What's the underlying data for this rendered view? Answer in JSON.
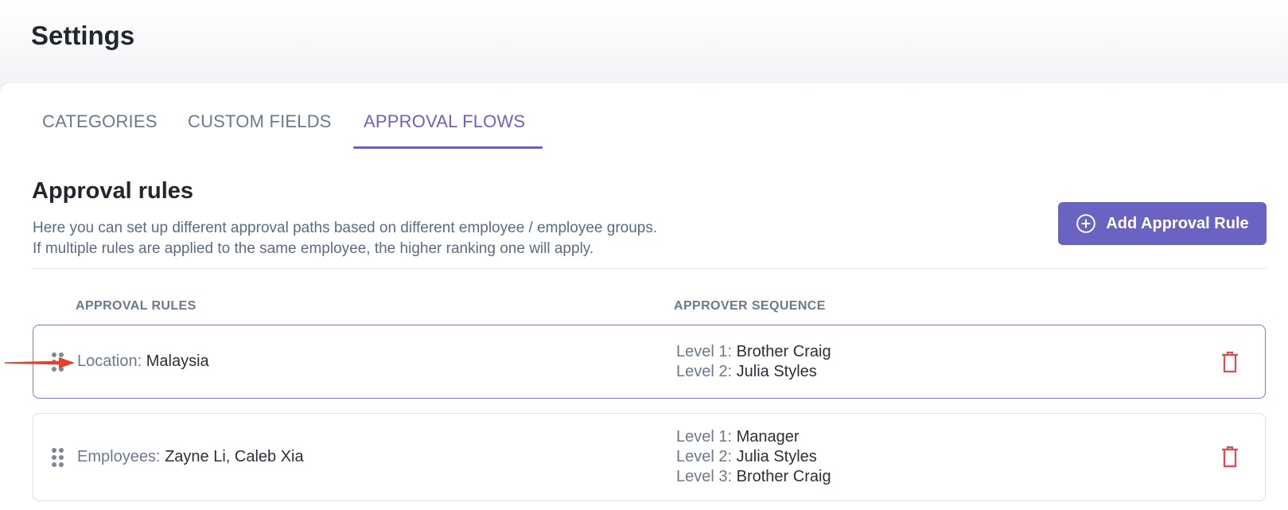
{
  "page": {
    "title": "Settings"
  },
  "tabs": [
    {
      "label": "CATEGORIES",
      "active": false
    },
    {
      "label": "CUSTOM FIELDS",
      "active": false
    },
    {
      "label": "APPROVAL FLOWS",
      "active": true
    }
  ],
  "section": {
    "title": "Approval rules",
    "description_line1": "Here you can set up different approval paths based on different employee / employee groups.",
    "description_line2": "If multiple rules are applied to the same employee, the higher ranking one will apply.",
    "add_button_label": "Add Approval Rule",
    "add_button_icon": "plus-circle-icon"
  },
  "table": {
    "col_rules": "APPROVAL RULES",
    "col_sequence": "APPROVER SEQUENCE",
    "rows": [
      {
        "key": "Location:",
        "value": "Malaysia",
        "selected": true,
        "levels": [
          {
            "label": "Level 1:",
            "name": "Brother Craig"
          },
          {
            "label": "Level 2:",
            "name": "Julia Styles"
          }
        ]
      },
      {
        "key": "Employees:",
        "value": "Zayne Li, Caleb Xia",
        "selected": false,
        "levels": [
          {
            "label": "Level 1:",
            "name": "Manager"
          },
          {
            "label": "Level 2:",
            "name": "Julia Styles"
          },
          {
            "label": "Level 3:",
            "name": "Brother Craig"
          }
        ]
      }
    ]
  },
  "colors": {
    "accent": "#6b63c1",
    "delete": "#e5484d",
    "annotation_arrow": "#e0442e"
  }
}
